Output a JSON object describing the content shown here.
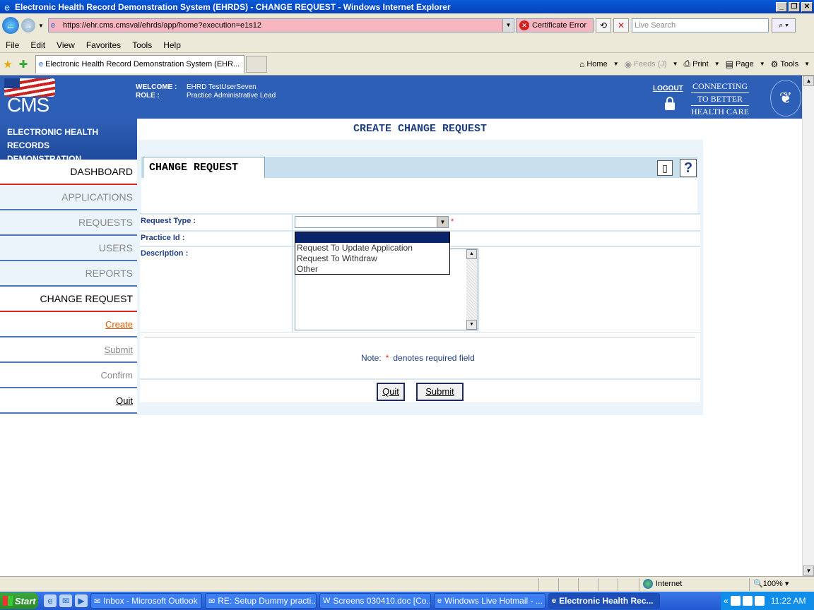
{
  "window": {
    "title": "Electronic Health Record Demonstration System (EHRDS) - CHANGE REQUEST - Windows Internet Explorer",
    "minimize": "_",
    "restore": "❐",
    "close": "✕"
  },
  "address": {
    "url": "https://ehr.cms.cmsval/ehrds/app/home?execution=e1s12",
    "cert_error": "Certificate Error",
    "search_placeholder": "Live Search"
  },
  "menu": [
    "File",
    "Edit",
    "View",
    "Favorites",
    "Tools",
    "Help"
  ],
  "tab": {
    "label": "Electronic Health Record Demonstration System (EHR..."
  },
  "command_bar": {
    "home": "Home",
    "feeds": "Feeds (J)",
    "print": "Print",
    "page": "Page",
    "tools": "Tools"
  },
  "header": {
    "logo_text": "CMS",
    "welcome_label": "WELCOME :",
    "welcome_value": "EHRD TestUserSeven",
    "role_label": "ROLE :",
    "role_value": "Practice Administrative Lead",
    "logout": "LOGOUT",
    "tagline": [
      "CONNECTING",
      "TO BETTER",
      "HEALTH CARE"
    ]
  },
  "left_banner": {
    "line1": "ELECTRONIC HEALTH RECORDS",
    "line2": "DEMONSTRATION"
  },
  "page_title": "CREATE CHANGE REQUEST",
  "sidebar": {
    "dashboard": "DASHBOARD",
    "applications": "APPLICATIONS",
    "requests": "REQUESTS",
    "users": "USERS",
    "reports": "REPORTS",
    "change_request": "CHANGE REQUEST",
    "create": "Create",
    "submit": "Submit",
    "confirm": "Confirm",
    "quit": "Quit"
  },
  "section": {
    "title": "CHANGE REQUEST"
  },
  "form": {
    "request_type_label": "Request Type :",
    "practice_id_label": "Practice Id :",
    "description_label": "Description :",
    "required_marker": "*",
    "request_type_options": [
      "",
      "Request To Update Application",
      "Request To Withdraw",
      "Other"
    ]
  },
  "note": {
    "prefix": "Note:",
    "star": "*",
    "text": "denotes required field"
  },
  "buttons": {
    "quit": "Quit",
    "submit": "Submit"
  },
  "status": {
    "zone": "Internet",
    "zoom": "100%"
  },
  "taskbar": {
    "start": "Start",
    "tasks": [
      "Inbox - Microsoft Outlook",
      "RE: Setup Dummy practi...",
      "Screens 030410.doc [Co...",
      "Windows Live Hotmail - ...",
      "Electronic Health Rec..."
    ],
    "clock": "11:22 AM"
  }
}
